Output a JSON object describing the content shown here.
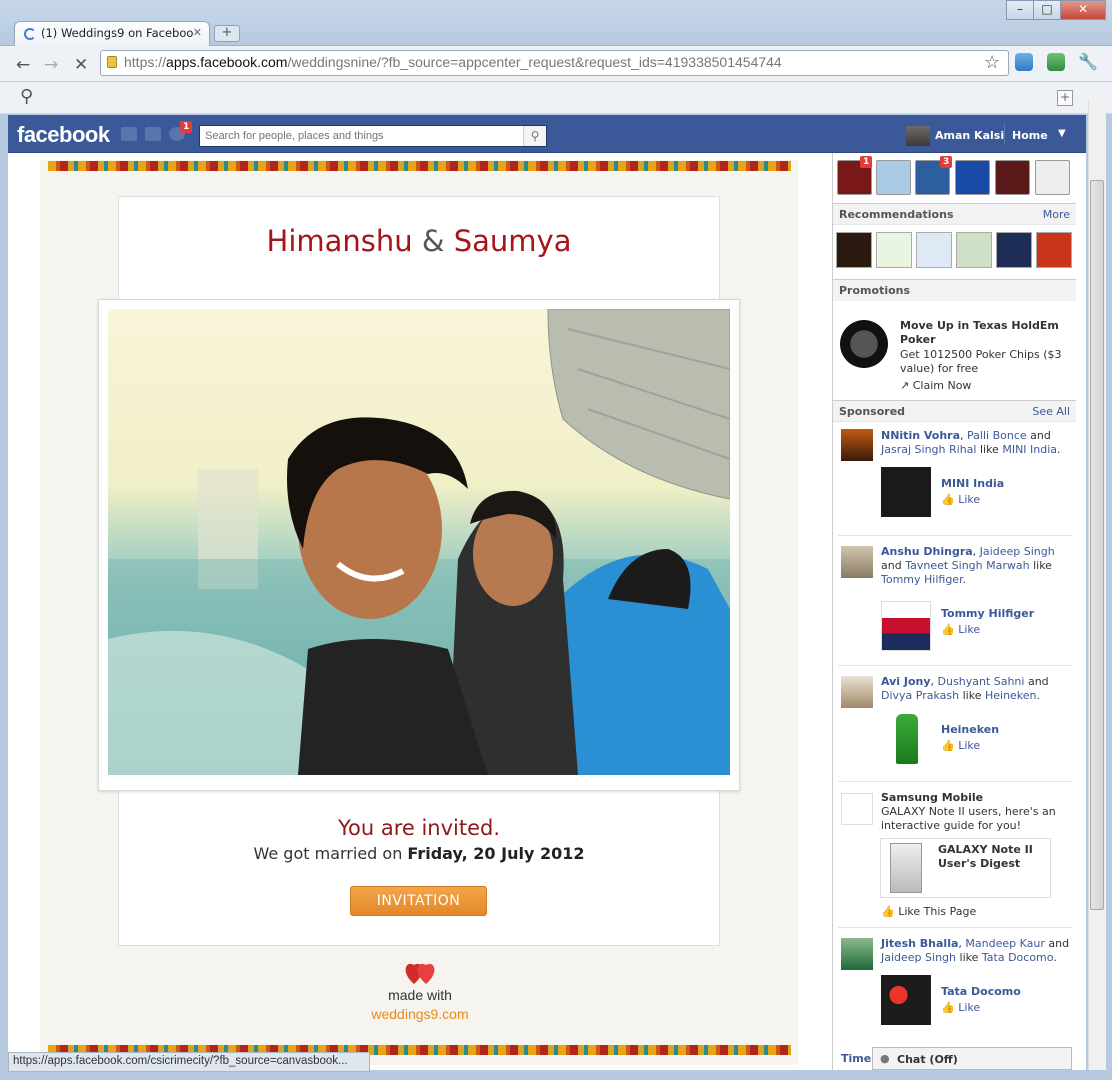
{
  "browser": {
    "tab_title": "(1) Weddings9 on Faceboo",
    "url_scheme": "https://",
    "url_host": "apps.facebook.com",
    "url_path": "/weddingsnine/?fb_source=appcenter_request&request_ids=419338501454744",
    "status_url": "https://apps.facebook.com/csicrimecity/?fb_source=canvasbook..."
  },
  "fb": {
    "logo": "facebook",
    "search_placeholder": "Search for people, places and things",
    "notification_count": "1",
    "user_name": "Aman Kalsi",
    "home_label": "Home"
  },
  "invite": {
    "name1": "Himanshu",
    "amp": "&",
    "name2": "Saumya",
    "invited": "You are invited.",
    "married_prefix": "We got married on",
    "married_date": "Friday, 20 July 2012",
    "button": "INVITATION",
    "made_with": "made with",
    "brand": "weddings9.com"
  },
  "sidebar": {
    "app_badges": [
      "1",
      "3"
    ],
    "recommendations": "Recommendations",
    "more": "More",
    "promotions": "Promotions",
    "promo_title": "Move Up in Texas HoldEm Poker",
    "promo_text": "Get 1012500 Poker Chips ($3 value) for free",
    "claim": "Claim Now",
    "sponsored": "Sponsored",
    "see_all": "See All",
    "ads": [
      {
        "n1": "NNitin Vohra",
        "sep1": ", ",
        "n2": "Palli Bonce",
        "mid": " and ",
        "n3": "Jasraj Singh Rihal",
        "tail": " like ",
        "page": "MINI India",
        "end": ".",
        "title": "MINI India",
        "like": "Like"
      },
      {
        "n1": "Anshu Dhingra",
        "sep1": ", ",
        "n2": "Jaideep Singh",
        "mid": " and ",
        "n3": "Tavneet Singh Marwah",
        "tail": " like ",
        "page": "Tommy Hilfiger",
        "end": ".",
        "title": "Tommy Hilfiger",
        "like": "Like"
      },
      {
        "n1": "Avi Jony",
        "sep1": ", ",
        "n2": "Dushyant Sahni",
        "mid": " and ",
        "n3": "Divya Prakash",
        "tail": " like ",
        "page": "Heineken",
        "end": ".",
        "title": "Heineken",
        "like": "Like"
      }
    ],
    "samsung_title": "Samsung Mobile",
    "samsung_text": "GALAXY Note II users, here's an interactive guide for you!",
    "samsung_card": "GALAXY Note II User's Digest",
    "like_page": "Like This Page",
    "ad4": {
      "n1": "Jitesh Bhalla",
      "n2": "Mandeep Kaur",
      "n3": "Jaideep Singh",
      "page": "Tata Docomo",
      "title": "Tata Docomo",
      "like": "Like"
    },
    "timeline": "Timel",
    "chat": "Chat (Off)"
  }
}
